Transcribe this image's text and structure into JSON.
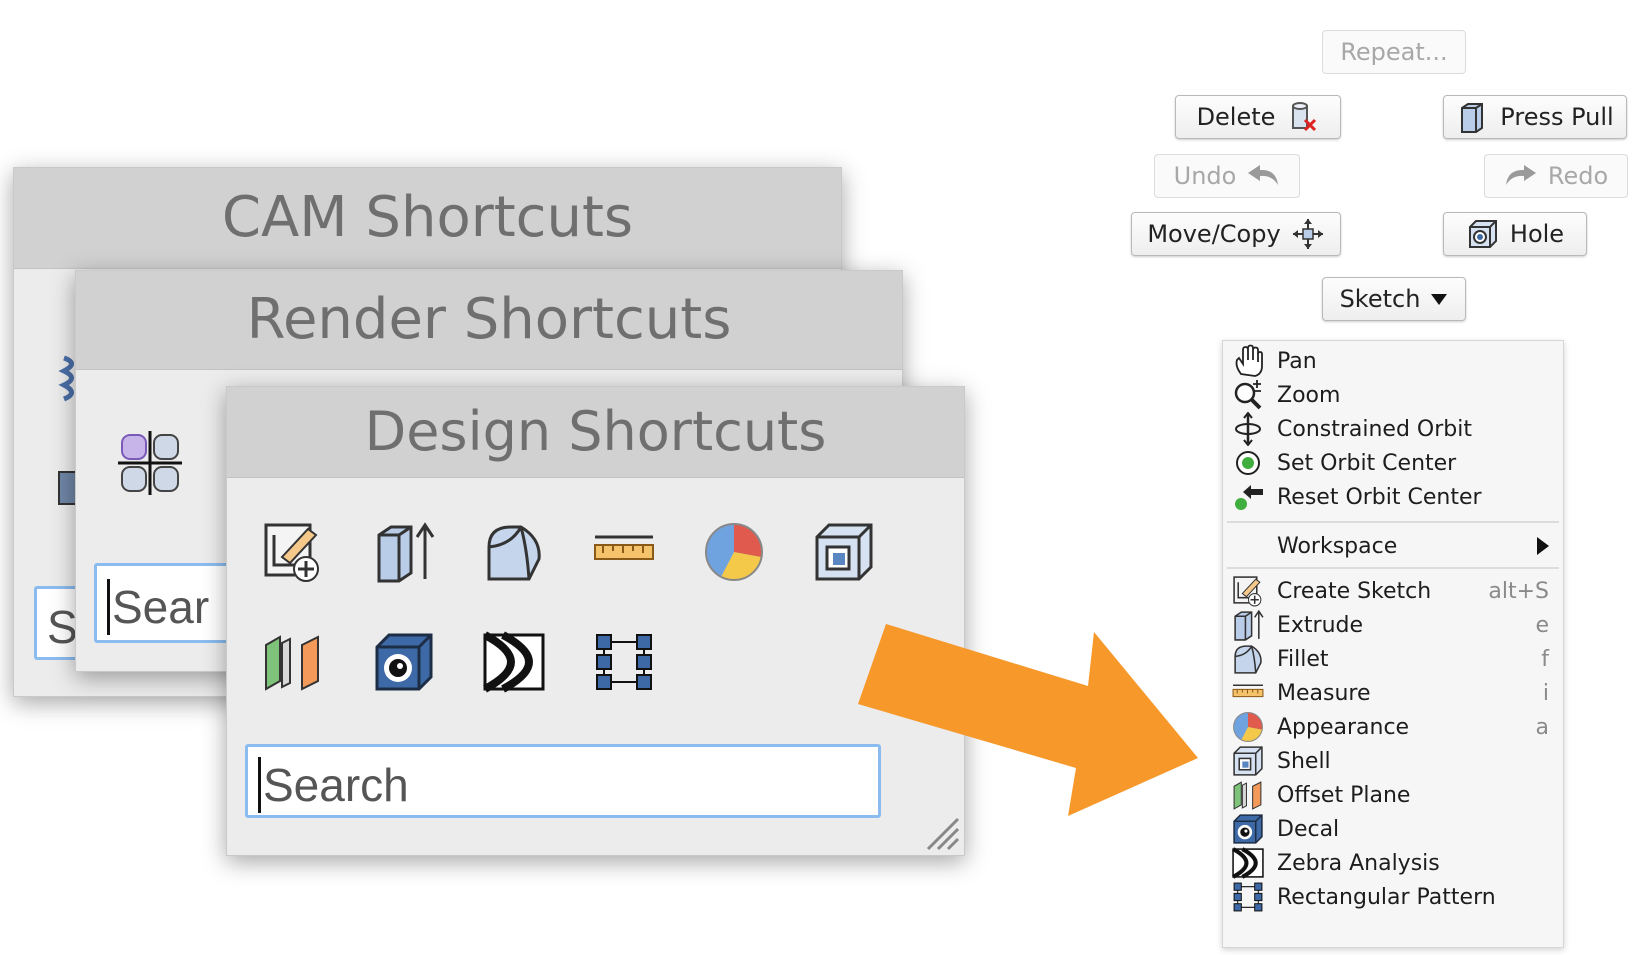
{
  "panels": {
    "cam": {
      "title": "CAM Shortcuts",
      "search_placeholder": "S"
    },
    "render": {
      "title": "Render Shortcuts",
      "search_placeholder": "Sear"
    },
    "design": {
      "title": "Design Shortcuts",
      "search_placeholder": "Search",
      "icons": [
        "create-sketch-icon",
        "extrude-icon",
        "fillet-icon",
        "measure-icon",
        "appearance-icon",
        "shell-icon",
        "offset-plane-icon",
        "decal-icon",
        "zebra-analysis-icon",
        "rectangular-pattern-icon"
      ]
    }
  },
  "toolbar": {
    "repeat": "Repeat...",
    "delete": "Delete",
    "press_pull": "Press Pull",
    "undo": "Undo",
    "redo": "Redo",
    "move_copy": "Move/Copy",
    "hole": "Hole",
    "sketch": "Sketch"
  },
  "menu": {
    "nav": [
      "Pan",
      "Zoom",
      "Constrained Orbit",
      "Set Orbit Center",
      "Reset Orbit Center"
    ],
    "workspace": "Workspace",
    "commands": [
      {
        "label": "Create Sketch",
        "shortcut": "alt+S"
      },
      {
        "label": "Extrude",
        "shortcut": "e"
      },
      {
        "label": "Fillet",
        "shortcut": "f"
      },
      {
        "label": "Measure",
        "shortcut": "i"
      },
      {
        "label": "Appearance",
        "shortcut": "a"
      },
      {
        "label": "Shell",
        "shortcut": ""
      },
      {
        "label": "Offset Plane",
        "shortcut": ""
      },
      {
        "label": "Decal",
        "shortcut": ""
      },
      {
        "label": "Zebra Analysis",
        "shortcut": ""
      },
      {
        "label": "Rectangular Pattern",
        "shortcut": ""
      }
    ]
  },
  "colors": {
    "accent_arrow": "#f7982a",
    "search_border": "#8bbcf0"
  }
}
